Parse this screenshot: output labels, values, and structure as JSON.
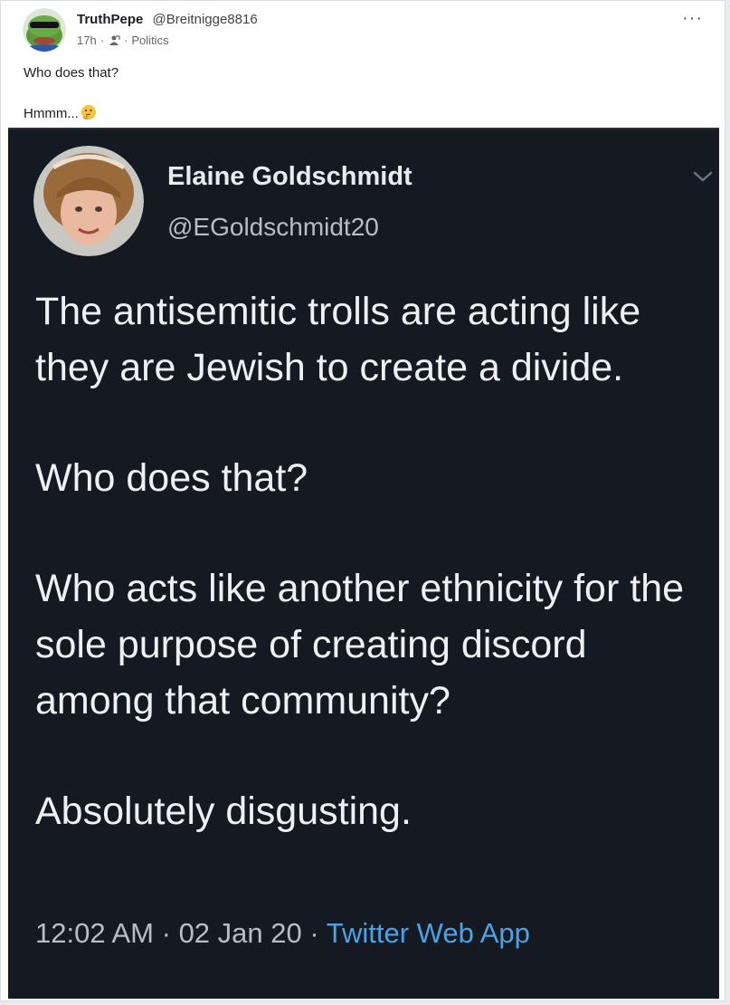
{
  "post": {
    "author_name": "TruthPepe",
    "author_handle": "@Breitnigge8816",
    "time": "17h",
    "separator": "·",
    "category": "Politics",
    "more_label": "···",
    "line1": "Who does that?",
    "line2": "Hmmm...",
    "emoji_icon": "thinking-face-icon"
  },
  "tweet": {
    "name": "Elaine Goldschmidt",
    "handle": "@EGoldschmidt20",
    "paragraphs": [
      "The antisemitic trolls are acting like they are Jewish to create a divide.",
      "Who does that?",
      "Who acts like another ethnicity for the sole purpose of creating discord among that community?",
      "Absolutely disgusting."
    ],
    "time": "12:02 AM",
    "date": "02 Jan 20",
    "footer_sep": "·",
    "app": "Twitter Web App"
  },
  "colors": {
    "tweet_bg": "#151a22",
    "link_blue": "#4aa3e6"
  }
}
